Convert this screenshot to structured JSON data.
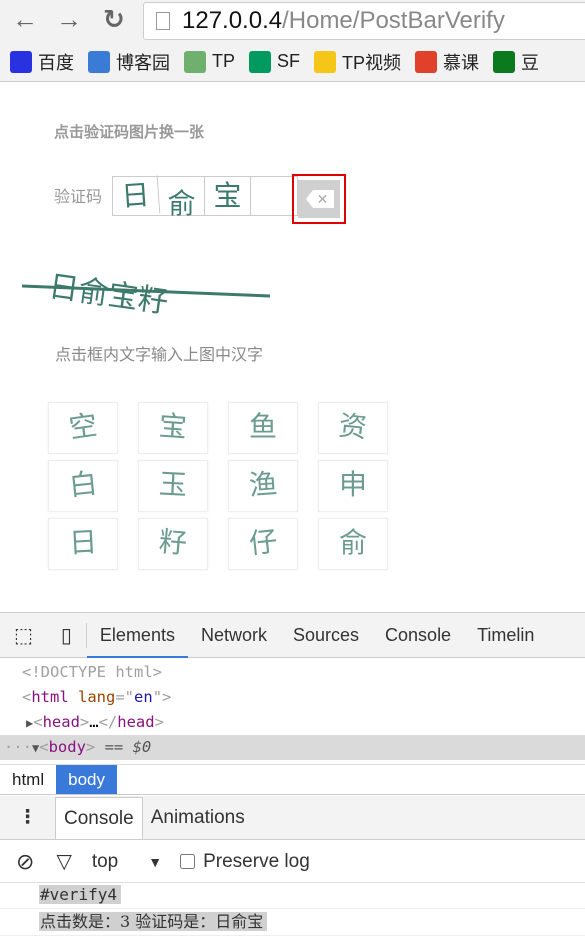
{
  "browser": {
    "url_host": "127.0.0.4",
    "url_path": "/Home/PostBarVerify",
    "bookmarks": [
      {
        "label": "百度",
        "icon": "baidu-icon",
        "color": "#2932e1"
      },
      {
        "label": "博客园",
        "icon": "cnblogs-icon",
        "color": "#3a7bd5"
      },
      {
        "label": "TP",
        "icon": "thinkphp-icon",
        "color": "#6fb06f"
      },
      {
        "label": "SF",
        "icon": "segmentfault-icon",
        "color": "#009a61"
      },
      {
        "label": "TP视频",
        "icon": "folder-icon",
        "color": "#f5c518"
      },
      {
        "label": "慕课",
        "icon": "imooc-icon",
        "color": "#e0412a"
      },
      {
        "label": "豆",
        "icon": "douban-icon",
        "color": "#0b7a1f"
      }
    ]
  },
  "page": {
    "refresh_hint": "点击验证码图片换一张",
    "verify_label": "验证码",
    "entered": [
      "日",
      "俞",
      "宝",
      ""
    ],
    "captcha_text": "日俞宝籽",
    "instruction": "点击框内文字输入上图中汉字",
    "grid": [
      "空",
      "宝",
      "鱼",
      "资",
      "白",
      "玉",
      "渔",
      "申",
      "日",
      "籽",
      "仔",
      "俞"
    ]
  },
  "devtools": {
    "tabs": [
      "Elements",
      "Network",
      "Sources",
      "Console",
      "Timelin"
    ],
    "active_tab": "Elements",
    "dom": {
      "doctype": "<!DOCTYPE html>",
      "html_tag": "html",
      "lang_attr": "lang",
      "lang_val": "en",
      "head": "head",
      "ellipsis": "…",
      "body": "body",
      "selected_marker": "== $0"
    },
    "breadcrumbs": [
      "html",
      "body"
    ],
    "drawer_tabs": [
      "Console",
      "Animations"
    ],
    "context": "top",
    "preserve_log": "Preserve log",
    "console": [
      "#verify4",
      "点击数是：3  验证码是：日俞宝"
    ]
  }
}
